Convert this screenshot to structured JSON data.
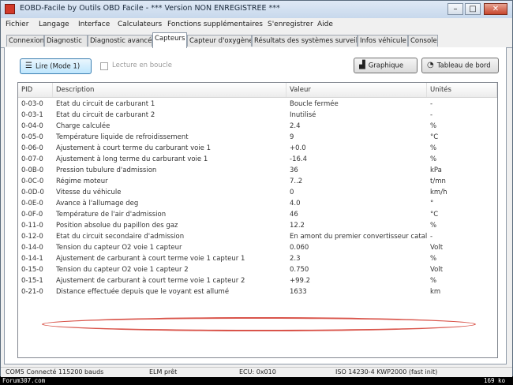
{
  "window": {
    "title": "EOBD-Facile by Outils OBD Facile - *** Version NON ENREGISTREE ***",
    "buttons": {
      "minimize": "–",
      "maximize": "□",
      "close": "✕"
    }
  },
  "menu": [
    "Fichier",
    "Langage",
    "Interface",
    "Calculateurs",
    "Fonctions supplémentaires",
    "S'enregistrer",
    "Aide"
  ],
  "tabs": [
    "Connexion",
    "Diagnostic",
    "Diagnostic avancé",
    "Capteurs",
    "Capteur d'oxygène",
    "Résultats des systèmes surveillés",
    "Infos véhicule",
    "Console"
  ],
  "active_tab": "Capteurs",
  "toolbar": {
    "read_button": "Lire (Mode 1)",
    "read_icon": "list-icon",
    "continuous_checkbox": "Lecture en boucle",
    "graph_button": "Graphique",
    "graph_icon": "chart-icon",
    "dashboard_button": "Tableau de bord",
    "dashboard_icon": "gauge-icon"
  },
  "table": {
    "headers": {
      "pid": "PID",
      "description": "Description",
      "value": "Valeur",
      "unit": "Unités"
    },
    "rows": [
      {
        "pid": "0-03-0",
        "description": "Etat du circuit de carburant 1",
        "value": "Boucle fermée",
        "unit": "-"
      },
      {
        "pid": "0-03-1",
        "description": "Etat du circuit de carburant 2",
        "value": "Inutilisé",
        "unit": "-"
      },
      {
        "pid": "0-04-0",
        "description": "Charge calculée",
        "value": "2.4",
        "unit": "%"
      },
      {
        "pid": "0-05-0",
        "description": "Température liquide de refroidissement",
        "value": "9",
        "unit": "°C"
      },
      {
        "pid": "0-06-0",
        "description": "Ajustement à court terme du carburant voie 1",
        "value": "+0.0",
        "unit": "%"
      },
      {
        "pid": "0-07-0",
        "description": "Ajustement à long terme du carburant voie 1",
        "value": "-16.4",
        "unit": "%"
      },
      {
        "pid": "0-0B-0",
        "description": "Pression tubulure d'admission",
        "value": "36",
        "unit": "kPa"
      },
      {
        "pid": "0-0C-0",
        "description": "Régime moteur",
        "value": "7..2",
        "unit": "t/mn"
      },
      {
        "pid": "0-0D-0",
        "description": "Vitesse du véhicule",
        "value": "0",
        "unit": "km/h"
      },
      {
        "pid": "0-0E-0",
        "description": "Avance à l'allumage deg",
        "value": "4.0",
        "unit": "°"
      },
      {
        "pid": "0-0F-0",
        "description": "Température de l'air d'admission",
        "value": "46",
        "unit": "°C"
      },
      {
        "pid": "0-11-0",
        "description": "Position absolue du papillon des gaz",
        "value": "12.2",
        "unit": "%"
      },
      {
        "pid": "0-12-0",
        "description": "Etat du circuit secondaire d'admission",
        "value": "En amont du premier convertisseur catalyt...",
        "unit": "-"
      },
      {
        "pid": "0-14-0",
        "description": "Tension du capteur O2 voie 1 capteur",
        "value": "0.060",
        "unit": "Volt"
      },
      {
        "pid": "0-14-1",
        "description": "Ajustement de carburant à court terme voie 1 capteur 1",
        "value": "2.3",
        "unit": "%"
      },
      {
        "pid": "0-15-0",
        "description": "Tension du capteur O2 voie 1 capteur 2",
        "value": "0.750",
        "unit": "Volt"
      },
      {
        "pid": "0-15-1",
        "description": "Ajustement de carburant à court terme voie 1 capteur 2",
        "value": "+99.2",
        "unit": "%"
      },
      {
        "pid": "0-21-0",
        "description": "Distance effectuée depuis que le voyant est allumé",
        "value": "1633",
        "unit": "km"
      }
    ]
  },
  "status": {
    "connection": "COM5 Connecté 115200 bauds",
    "elm": "ELM prêt",
    "ecu": "ECU: 0x010",
    "protocol": "ISO 14230-4 KWP2000 (fast init)"
  },
  "watermark": {
    "left": "Forum307.com",
    "right": "169 ko"
  },
  "colors": {
    "highlight_ellipse": "#d9544a",
    "active_button": "#bee6fd"
  }
}
